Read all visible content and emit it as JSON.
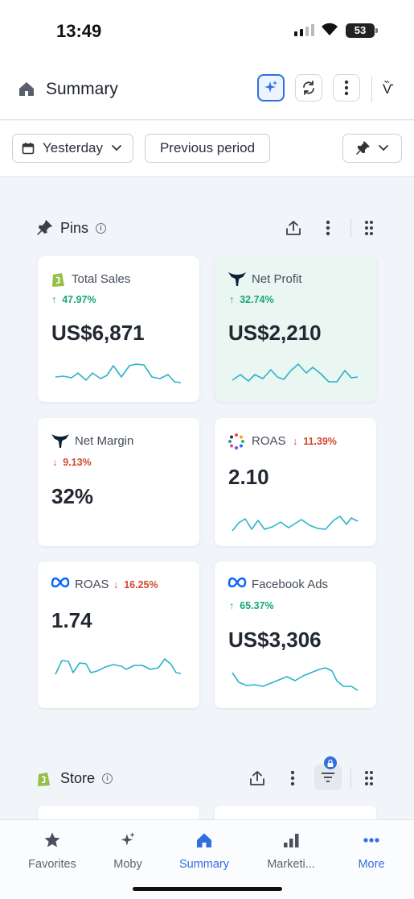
{
  "status_bar": {
    "time": "13:49",
    "battery": "53"
  },
  "header": {
    "title": "Summary",
    "logo": "Ѷ"
  },
  "filters": {
    "date_range": "Yesterday",
    "compare": "Previous period"
  },
  "pins_section": {
    "title": "Pins",
    "cards": [
      {
        "title": "Total Sales",
        "delta": "47.97%",
        "direction": "up",
        "value": "US$6,871",
        "icon": "shopify-icon"
      },
      {
        "title": "Net Profit",
        "delta": "32.74%",
        "direction": "up",
        "value": "US$2,210",
        "icon": "triple-whale-icon"
      },
      {
        "title": "Net Margin",
        "delta": "9.13%",
        "direction": "down",
        "value": "32%",
        "icon": "triple-whale-icon"
      },
      {
        "title": "ROAS",
        "delta": "11.39%",
        "direction": "down",
        "value": "2.10",
        "icon": "multi-channel-dots-icon"
      },
      {
        "title": "ROAS",
        "delta": "16.25%",
        "direction": "down",
        "value": "1.74",
        "icon": "meta-icon"
      },
      {
        "title": "Facebook Ads",
        "delta": "65.37%",
        "direction": "up",
        "value": "US$3,306",
        "icon": "meta-icon"
      }
    ]
  },
  "store_section": {
    "title": "Store"
  },
  "bottom_nav": {
    "items": [
      {
        "label": "Favorites",
        "icon": "star-icon"
      },
      {
        "label": "Moby",
        "icon": "sparkle-icon"
      },
      {
        "label": "Summary",
        "icon": "home-icon"
      },
      {
        "label": "Marketi...",
        "icon": "bar-chart-icon"
      },
      {
        "label": "More",
        "icon": "more-dots-icon"
      }
    ]
  },
  "colors": {
    "accent": "#2f6fe0",
    "up": "#1aa871",
    "down": "#d2492f",
    "sparkline": "#2bb3c9"
  }
}
